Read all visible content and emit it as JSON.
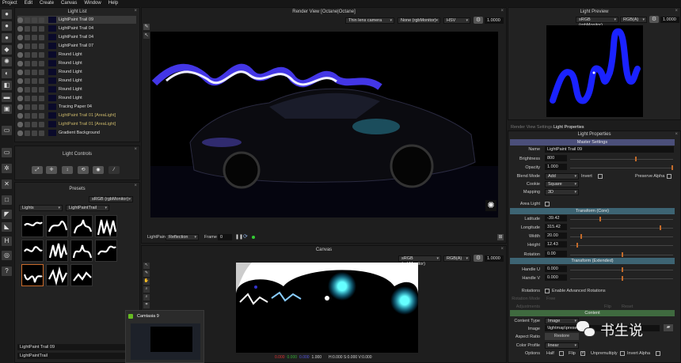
{
  "menu": [
    "Project",
    "Edit",
    "Create",
    "Canvas",
    "Window",
    "Help"
  ],
  "light_list": {
    "title": "Light List",
    "items": [
      {
        "label": "LightPaint Trail 09",
        "selected": true,
        "area": false
      },
      {
        "label": "LightPaint Trail 04",
        "area": false
      },
      {
        "label": "LightPaint Trail 04",
        "area": false
      },
      {
        "label": "LightPaint Trail 07",
        "area": false
      },
      {
        "label": "Round Light",
        "area": false
      },
      {
        "label": "Round Light",
        "area": false
      },
      {
        "label": "Round Light",
        "area": false
      },
      {
        "label": "Round Light",
        "area": false
      },
      {
        "label": "Round Light",
        "area": false
      },
      {
        "label": "Round Light",
        "area": false
      },
      {
        "label": "Tracing Paper 04",
        "area": false
      },
      {
        "label": "LightPaint Trail 01 [AreaLight]",
        "area": true
      },
      {
        "label": "LightPaint Trail 01 [AreaLight]",
        "area": true
      },
      {
        "label": "Gradient Background",
        "area": false
      }
    ]
  },
  "light_controls": {
    "title": "Light Controls"
  },
  "presets": {
    "title": "Presets",
    "color_space": "sRGB (rgbMonitor)",
    "category": "Lights",
    "subcategory": "LightPaintTrail",
    "selected_name": "LightPaint Trail 09",
    "folder": "LightPaintTrail"
  },
  "render_view": {
    "title": "Render View [Octane|Octane]",
    "camera": "Thin lens camera",
    "lut": "None (rgbMonitor)",
    "mode": "HSV",
    "exposure": "1.0000",
    "lightpaint_label": "LightPaint",
    "lightpaint_mode": "Reflection",
    "frame_label": "Frame",
    "frame": "0"
  },
  "canvas": {
    "title": "Canvas",
    "color_space": "sRGB (rgbMonitor)",
    "channels": "RGB(A)",
    "exposure": "1.0000",
    "r": "0.000",
    "g": "0.000",
    "b": "0.000",
    "a": "1.000",
    "hsv": "H:0.000 S:0.000 V:0.000"
  },
  "light_preview": {
    "title": "Light Preview",
    "color_space": "sRGB (rgbMonitor)",
    "channels": "RGB(A)",
    "exposure": "1.0000"
  },
  "tabs": [
    "Render View Settings",
    "Light Properties"
  ],
  "props": {
    "title": "Light Properties",
    "master": "Master Settings",
    "name_label": "Name",
    "name": "LightPaint Trail 09",
    "brightness_label": "Brightness",
    "brightness": "800",
    "opacity_label": "Opacity",
    "opacity": "1.000",
    "blend_label": "Blend Mode",
    "blend": "Add",
    "invert_label": "Invert",
    "preserve_alpha_label": "Preserve Alpha",
    "cookie_label": "Cookie",
    "cookie": "Square",
    "mapping_label": "Mapping",
    "mapping": "3D",
    "area_light_label": "Area Light",
    "transform_core": "Transform (Core)",
    "latitude_label": "Latitude",
    "latitude": "-39.42",
    "longitude_label": "Longitude",
    "longitude": "315.42",
    "width_label": "Width",
    "width": "20.00",
    "height_label": "Height",
    "height": "12.43",
    "rotation_label": "Rotation",
    "rotation": "0.00",
    "transform_ext": "Transform (Extended)",
    "handle_u_label": "Handle U",
    "handle_u": "0.000",
    "handle_v_label": "Handle V",
    "handle_v": "0.000",
    "rotations_label": "Rotations",
    "adv_rot_label": "Enable Advanced Rotations",
    "rotation_mode_label": "Rotation Mode",
    "rotation_mode": "Free",
    "adjustments_label": "Adjustments",
    "flip_label2": "Flip",
    "reset_label": "Reset",
    "content": "Content",
    "content_type_label": "Content Type",
    "content_type": "Image",
    "image_label": "Image",
    "image_path": "\\lightmap\\presets\\",
    "aspect_label": "Aspect Ratio",
    "restore": "Restore",
    "color_profile_label": "Color Profile",
    "color_profile": "linear",
    "options_label": "Options",
    "half_label": "Half",
    "flip_label": "Flip",
    "unpremultiply_label": "Unpremultiply",
    "invert_alpha_label": "Invert Alpha"
  },
  "taskbar_popup": {
    "title": "Camtasia 9"
  },
  "watermark": "书生说",
  "colors": {
    "master": "#4b4f7a",
    "transform": "#3d6473",
    "content": "#3f6a3f",
    "accent": "#c26a2a"
  }
}
